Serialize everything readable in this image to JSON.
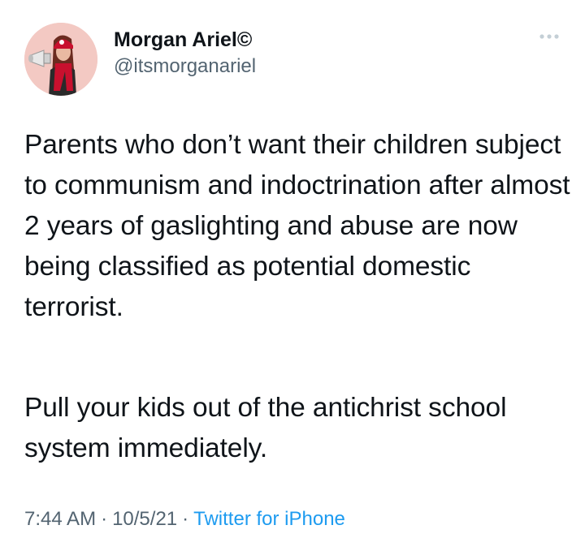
{
  "tweet": {
    "display_name": "Morgan Ariel©",
    "handle": "@itsmorganariel",
    "paragraphs": [
      "Parents who don’t want their children subject to communism and indoctrination after almost 2 years of gaslighting and abuse are now being classified as potential domestic terrorist.",
      "Pull your kids out of the antichrist school system immediately."
    ],
    "time": "7:44 AM",
    "date": "10/5/21",
    "separator": "·",
    "source": "Twitter for iPhone"
  },
  "icons": {
    "avatar": "avatar-megaphone-photo",
    "more": "more-options-icon"
  },
  "colors": {
    "text": "#0f1419",
    "muted": "#536471",
    "link": "#1d9bf0",
    "avatar_bg": "#f3c9c3",
    "beanie": "#c8102e"
  }
}
